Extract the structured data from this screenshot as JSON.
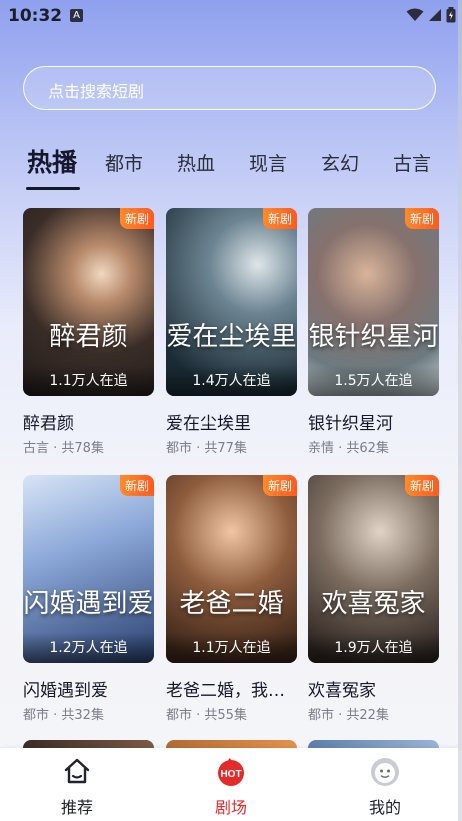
{
  "status_bar": {
    "time": "10:32",
    "badge": "A"
  },
  "search": {
    "placeholder": "点击搜索短剧"
  },
  "tabs": [
    "热播",
    "都市",
    "热血",
    "现言",
    "玄幻",
    "古言"
  ],
  "dramas": [
    {
      "title": "醉君颜",
      "genre": "古言",
      "episodes": "共78集",
      "meta": "古言 · 共78集",
      "viewers": "1.1万人在追",
      "badge": "新剧",
      "poster_text": "醉君颜"
    },
    {
      "title": "爱在尘埃里",
      "genre": "都市",
      "episodes": "共77集",
      "meta": "都市 · 共77集",
      "viewers": "1.4万人在追",
      "badge": "新剧",
      "poster_text": "爱在尘埃里"
    },
    {
      "title": "银针织星河",
      "genre": "亲情",
      "episodes": "共62集",
      "meta": "亲情 · 共62集",
      "viewers": "1.5万人在追",
      "badge": "新剧",
      "poster_text": "银针织星河"
    },
    {
      "title": "闪婚遇到爱",
      "genre": "都市",
      "episodes": "共32集",
      "meta": "都市 · 共32集",
      "viewers": "1.2万人在追",
      "badge": "新剧",
      "poster_text": "闪婚遇到爱"
    },
    {
      "title": "老爸二婚，我…",
      "genre": "都市",
      "episodes": "共55集",
      "meta": "都市 · 共55集",
      "viewers": "1.1万人在追",
      "badge": "新剧",
      "poster_text": "老爸二婚"
    },
    {
      "title": "欢喜冤家",
      "genre": "都市",
      "episodes": "共22集",
      "meta": "都市 · 共22集",
      "viewers": "1.9万人在追",
      "badge": "新剧",
      "poster_text": "欢喜冤家"
    }
  ],
  "bottom_nav": [
    {
      "label": "推荐",
      "icon": "home-icon",
      "active": false
    },
    {
      "label": "剧场",
      "icon": "hot-icon",
      "active": true,
      "icon_text": "HOT"
    },
    {
      "label": "我的",
      "icon": "profile-icon",
      "active": false
    }
  ],
  "colors": {
    "accent": "#e32b2b",
    "badge": "#ff6a22",
    "text": "#15172a",
    "meta": "#7b7e8a"
  }
}
